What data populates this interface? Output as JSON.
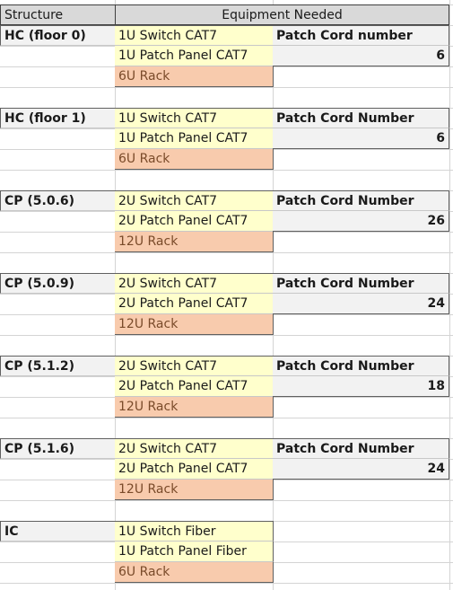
{
  "header": {
    "structure_label": "Structure",
    "equipment_label": "Equipment Needed"
  },
  "blocks": [
    {
      "structure": "HC (floor 0)",
      "switch": "1U Switch CAT7",
      "patch_panel": "1U Patch Panel CAT7",
      "rack": "6U Rack",
      "patch_cord_label": "Patch Cord number",
      "patch_cord_count": "6"
    },
    {
      "structure": "HC (floor 1)",
      "switch": "1U Switch CAT7",
      "patch_panel": "1U Patch Panel CAT7",
      "rack": "6U Rack",
      "patch_cord_label": "Patch Cord Number",
      "patch_cord_count": "6"
    },
    {
      "structure": "CP (5.0.6)",
      "switch": "2U Switch CAT7",
      "patch_panel": "2U Patch Panel CAT7",
      "rack": "12U Rack",
      "patch_cord_label": "Patch Cord Number",
      "patch_cord_count": "26"
    },
    {
      "structure": "CP (5.0.9)",
      "switch": "2U Switch CAT7",
      "patch_panel": "2U Patch Panel CAT7",
      "rack": "12U Rack",
      "patch_cord_label": "Patch Cord Number",
      "patch_cord_count": "24"
    },
    {
      "structure": "CP (5.1.2)",
      "switch": "2U Switch CAT7",
      "patch_panel": "2U Patch Panel CAT7",
      "rack": "12U Rack",
      "patch_cord_label": "Patch Cord Number",
      "patch_cord_count": "18"
    },
    {
      "structure": "CP (5.1.6)",
      "switch": "2U Switch CAT7",
      "patch_panel": "2U Patch Panel CAT7",
      "rack": "12U Rack",
      "patch_cord_label": "Patch Cord Number",
      "patch_cord_count": "24"
    },
    {
      "structure": "IC",
      "switch": "1U Switch Fiber",
      "patch_panel": "1U Patch Panel Fiber",
      "rack": "6U Rack"
    }
  ],
  "colors": {
    "equipment_fill": "#ffffcc",
    "rack_fill": "#f8cbad",
    "label_fill": "#f2f2f2",
    "header_fill": "#d9d9d9"
  }
}
